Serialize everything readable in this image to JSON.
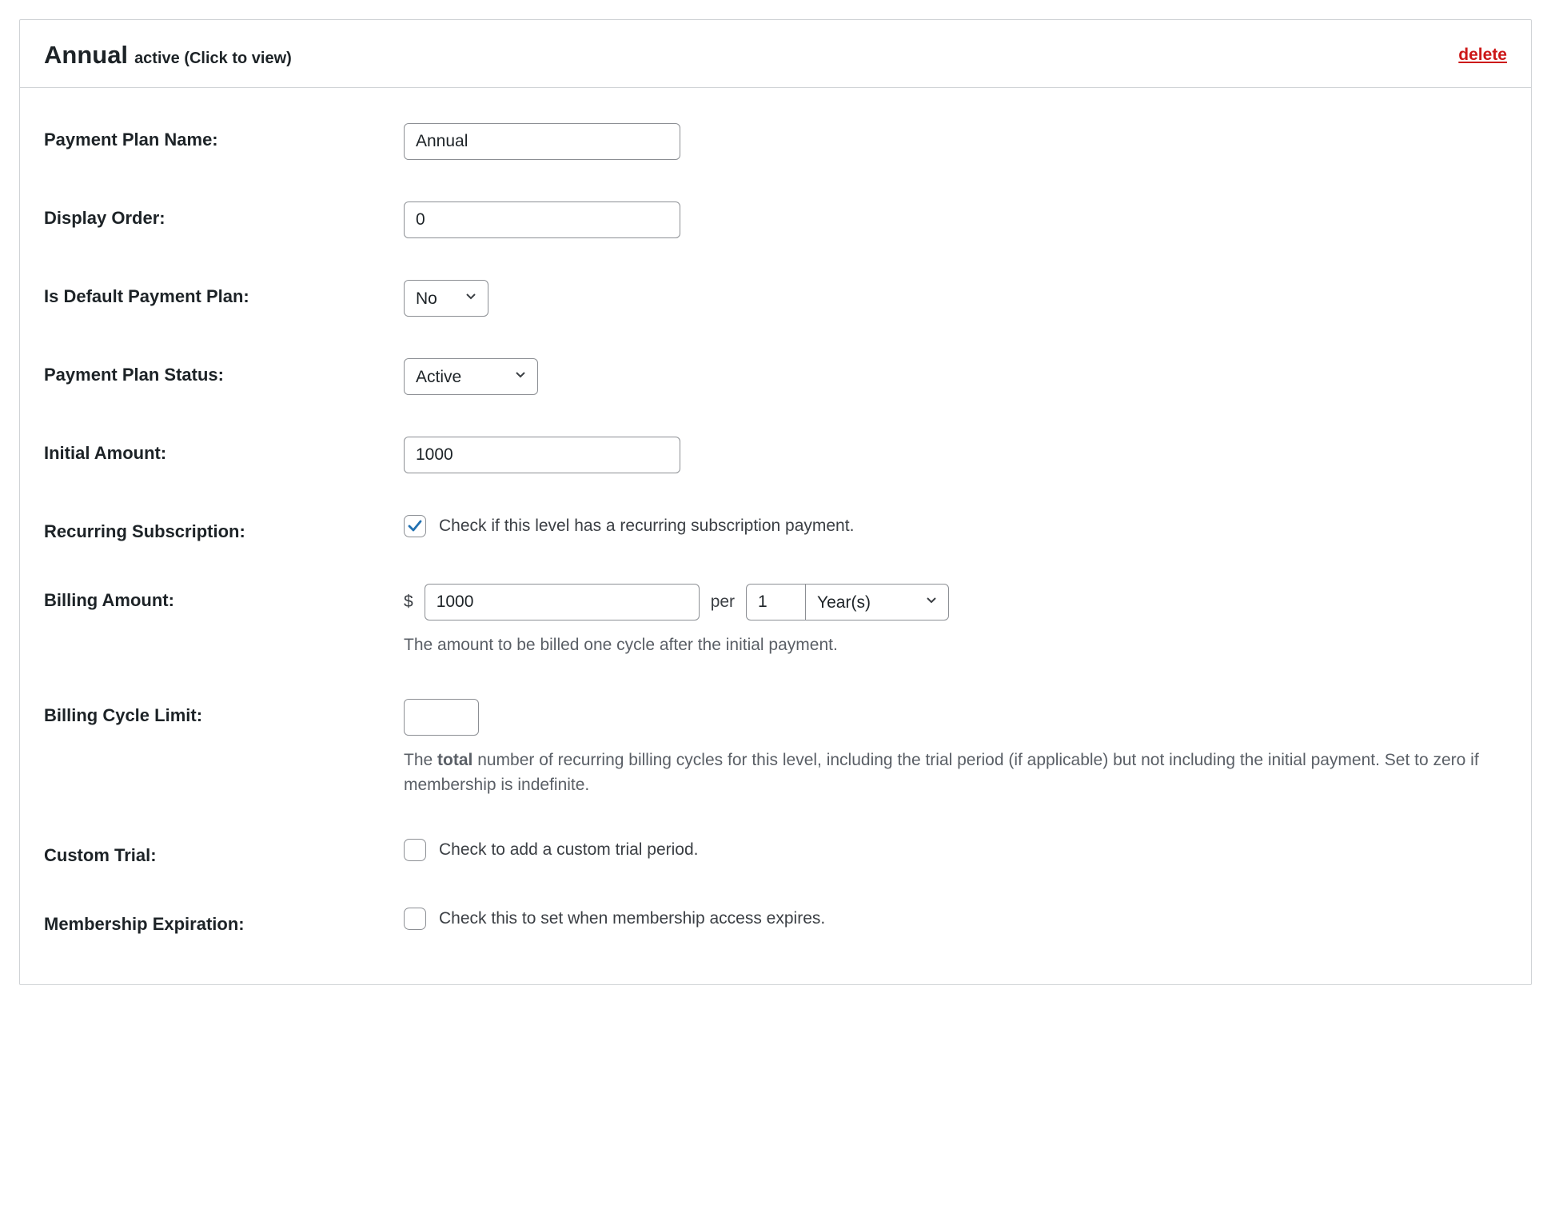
{
  "header": {
    "title": "Annual",
    "subtitle": "active (Click to view)",
    "delete_label": "delete"
  },
  "labels": {
    "plan_name": "Payment Plan Name:",
    "display_order": "Display Order:",
    "is_default": "Is Default Payment Plan:",
    "status": "Payment Plan Status:",
    "initial_amount": "Initial Amount:",
    "recurring": "Recurring Subscription:",
    "billing_amount": "Billing Amount:",
    "billing_cycle_limit": "Billing Cycle Limit:",
    "custom_trial": "Custom Trial:",
    "expiration": "Membership Expiration:"
  },
  "values": {
    "plan_name": "Annual",
    "display_order": "0",
    "is_default": "No",
    "status": "Active",
    "initial_amount": "1000",
    "billing_amount": "1000",
    "billing_count": "1",
    "billing_unit": "Year(s)",
    "billing_cycle_limit": ""
  },
  "text": {
    "currency_symbol": "$",
    "per": "per",
    "recurring_check": "Check if this level has a recurring subscription payment.",
    "billing_amount_help": "The amount to be billed one cycle after the initial payment.",
    "cycle_limit_help_prefix": "The ",
    "cycle_limit_help_bold": "total",
    "cycle_limit_help_suffix": " number of recurring billing cycles for this level, including the trial period (if applicable) but not including the initial payment. Set to zero if membership is indefinite.",
    "custom_trial_check": "Check to add a custom trial period.",
    "expiration_check": "Check this to set when membership access expires."
  },
  "checks": {
    "recurring": true,
    "custom_trial": false,
    "expiration": false
  }
}
